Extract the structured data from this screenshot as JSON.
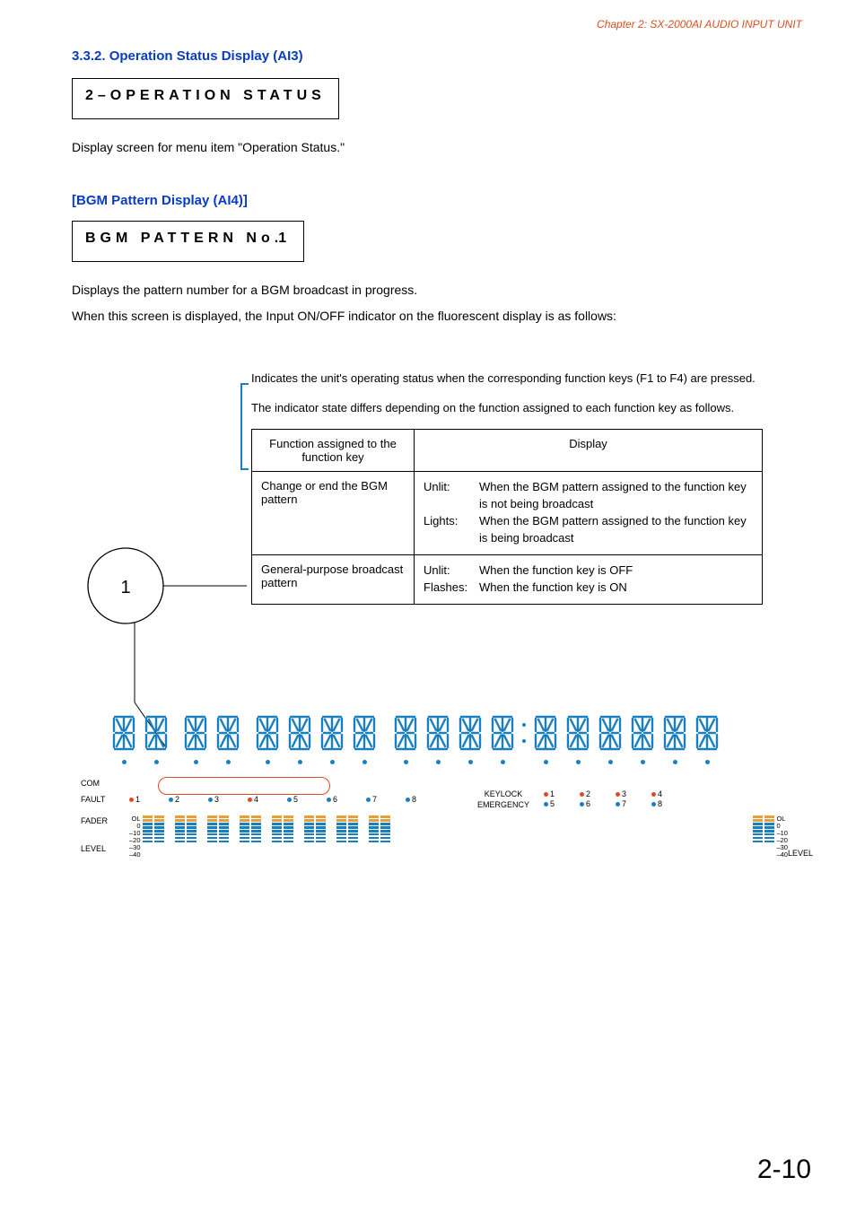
{
  "chapter_header": "Chapter 2: SX-2000AI AUDIO INPUT UNIT",
  "section": {
    "number_title": "3.3.2. Operation Status Display (AI3)",
    "lcd_text": "2–OPERATION STATUS",
    "description": "Display screen for menu item \"Operation Status.\""
  },
  "bgm": {
    "heading": "[BGM Pattern Display (AI4)]",
    "lcd_prefix": "BGM PATTERN No",
    "lcd_dot": ".",
    "lcd_suffix": "1",
    "description1": "Displays the pattern number for a BGM broadcast in progress.",
    "description2": "When this screen is displayed, the Input ON/OFF indicator on the fluorescent display is as follows:"
  },
  "callout": {
    "lead_text1": "Indicates the unit's operating status when the corresponding function keys (F1 to F4) are pressed.",
    "lead_text2": "The indicator state differs depending on the function assigned to each function key as follows.",
    "number": "1",
    "table": {
      "head_col1": "Function assigned to the function key",
      "head_col2": "Display",
      "rows": [
        {
          "c1": "Change or end the BGM pattern",
          "c2": [
            {
              "k": "Unlit:",
              "v": "When the BGM pattern assigned to the function key is not being broadcast"
            },
            {
              "k": "Lights:",
              "v": "When the BGM pattern assigned to the function key is being broadcast"
            }
          ]
        },
        {
          "c1": "General-purpose broadcast pattern",
          "c2": [
            {
              "k": "Unlit:",
              "v": "When the function key is OFF"
            },
            {
              "k": "Flashes:",
              "v": "When the function key is ON"
            }
          ]
        }
      ]
    }
  },
  "panel": {
    "labels": {
      "com": "COM",
      "fault": "FAULT",
      "fader": "FADER",
      "level_left": "LEVEL",
      "level_right": "LEVEL",
      "keylock": "KEYLOCK",
      "emergency": "EMERGENCY"
    },
    "scale": [
      "OL",
      "0",
      "–10",
      "–20",
      "–30",
      "–40"
    ],
    "fault_channels": [
      "1",
      "2",
      "3",
      "4",
      "5",
      "6",
      "7",
      "8"
    ],
    "status_pairs": [
      {
        "top": "1",
        "bot": "5"
      },
      {
        "top": "2",
        "bot": "6"
      },
      {
        "top": "3",
        "bot": "7"
      },
      {
        "top": "4",
        "bot": "8"
      }
    ]
  },
  "page_number": "2-10"
}
